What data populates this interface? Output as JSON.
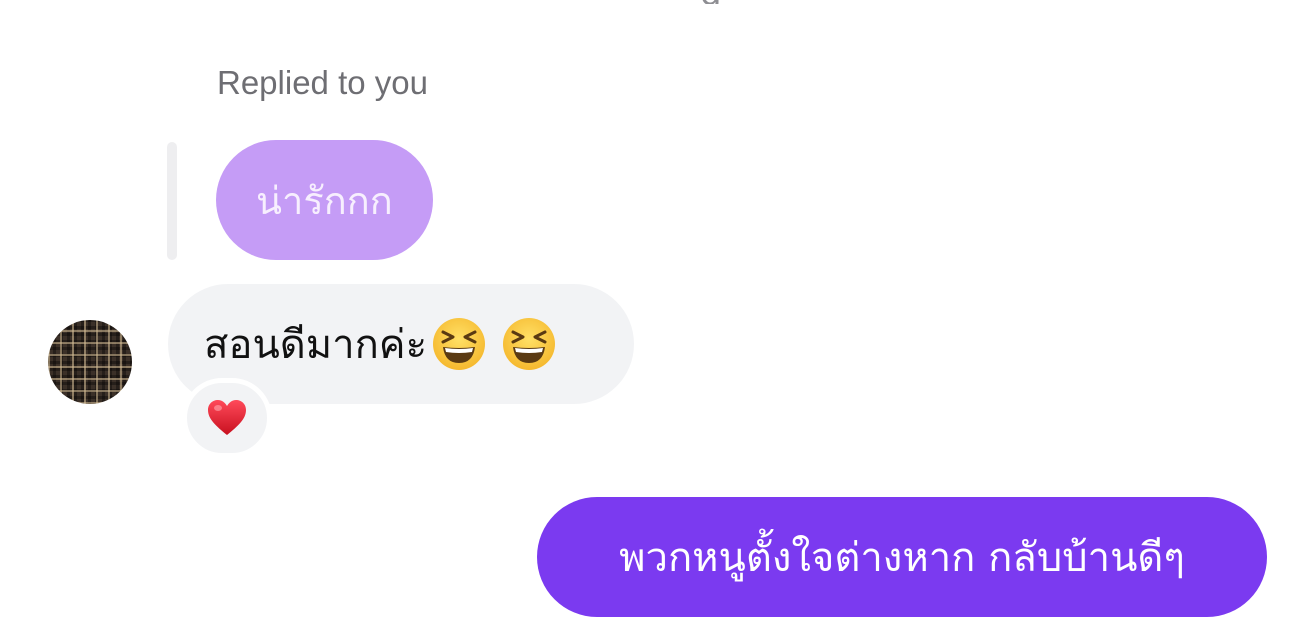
{
  "top_cut_text": "g",
  "reply": {
    "label": "Replied to you",
    "quoted_text": "น่ารักกก"
  },
  "incoming": {
    "text": "สอนดีมากค่ะ",
    "emojis": [
      "grinning-squinting-face-icon",
      "grinning-squinting-face-icon"
    ],
    "reaction": "heart-icon"
  },
  "outgoing": {
    "text": "พวกหนูตั้งใจต่างหาก กลับบ้านดีๆ"
  },
  "colors": {
    "quoted_bubble": "#c59cf6",
    "incoming_bubble": "#f2f3f5",
    "outgoing_bubble": "#7b3af0",
    "heart": "#e02233"
  }
}
